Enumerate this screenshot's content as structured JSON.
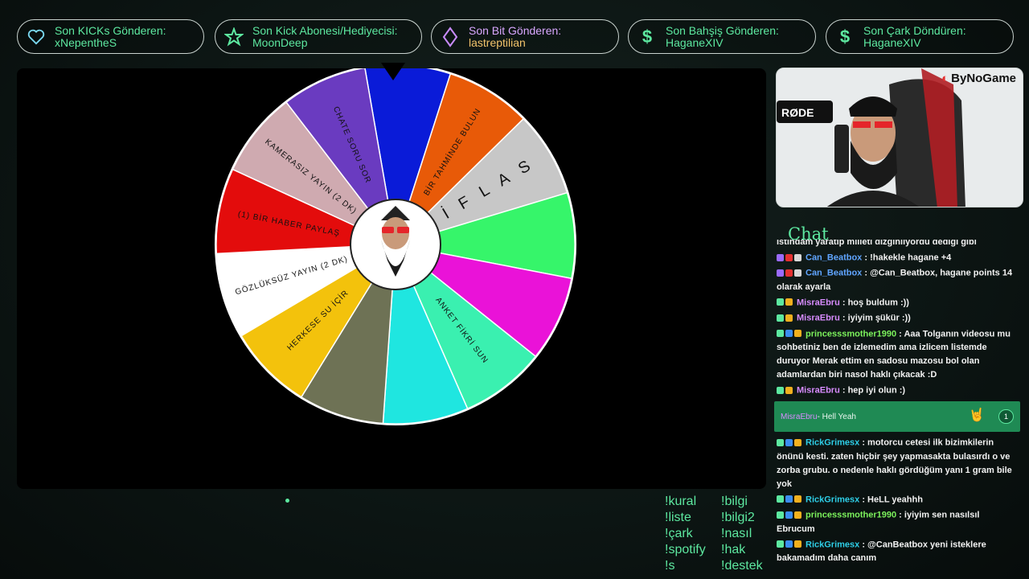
{
  "alerts": [
    {
      "label": "Son KICKs Gönderen:",
      "value": "xNepentheS",
      "icon": "heart-icon"
    },
    {
      "label": "Son Kick Abonesi/Hediyecisi:",
      "value": "MoonDeep",
      "icon": "star-icon"
    },
    {
      "label": "Son Bit Gönderen:",
      "value": "lastreptilian",
      "icon": "diamond-icon"
    },
    {
      "label": "Son Bahşiş Gönderen:",
      "value": "HaganeXIV",
      "icon": "dollar-icon"
    },
    {
      "label": "Son Çark Döndüren:",
      "value": "HaganeXIV",
      "icon": "dollar-icon"
    }
  ],
  "wheel": {
    "segments": [
      {
        "label": "",
        "color": "#0a1bd8"
      },
      {
        "label": "BİR TAHMİNDE BULUN",
        "color": "#e85a08"
      },
      {
        "label": "İ F L A S",
        "color": "#c7c7c7"
      },
      {
        "label": "",
        "color": "#36f56a"
      },
      {
        "label": "",
        "color": "#ea12d8"
      },
      {
        "label": "ANKET FİKRİ SUN",
        "color": "#3af0b0"
      },
      {
        "label": "",
        "color": "#1fe6e0"
      },
      {
        "label": "",
        "color": "#6e7255"
      },
      {
        "label": "HERKESE SU İÇİR",
        "color": "#f3c20c"
      },
      {
        "label": "GÖZLÜKSÜZ YAYIN (2 DK)",
        "color": "#ffffff"
      },
      {
        "label": "(1) BİR HABER PAYLAŞ",
        "color": "#e30c0c"
      },
      {
        "label": "KAMERASIZ YAYIN (2 DK)",
        "color": "#cfaab0"
      },
      {
        "label": "CHATE SORU SOR",
        "color": "#6a3bc0"
      }
    ]
  },
  "camera": {
    "brand": "ByNoGame"
  },
  "chat": {
    "title": "Chat",
    "partial_top": "istihdam yaratıp milleti dizginliyordu dediği gibi",
    "messages": [
      {
        "user": "Can_Beatbox",
        "cls": "u-can",
        "text": " : !hakekle hagane +4"
      },
      {
        "user": "Can_Beatbox",
        "cls": "u-can",
        "text": " : @Can_Beatbox, hagane points 14 olarak ayarla"
      },
      {
        "user": "MisraEbru",
        "cls": "u-misra",
        "text": " : hoş buldum :))"
      },
      {
        "user": "MisraEbru",
        "cls": "u-misra",
        "text": " : iyiyim şükür :))"
      },
      {
        "user": "princesssmother1990",
        "cls": "u-prin",
        "text": " : Aaa Tolganın videosu mu sohbetiniz ben de izlemedim ama izlicem listemde duruyor Merak ettim en sadosu mazosu bol olan adamlardan biri nasol haklı çıkacak :D"
      },
      {
        "user": "MisraEbru",
        "cls": "u-misra",
        "text": " : hep iyi olun :)"
      }
    ],
    "highlight": {
      "user": "MisraEbru",
      "text": " - Hell Yeah",
      "count": "1"
    },
    "messages2": [
      {
        "user": "RickGrimesx",
        "cls": "u-rick",
        "text": " : motorcu cetesi ilk bizimkilerin önünü kesti. zaten hiçbir şey yapmasakta bulasırdı o ve zorba grubu. o nedenle haklı gördüğüm yanı 1 gram bile yok"
      },
      {
        "user": "RickGrimesx",
        "cls": "u-rick",
        "text": " : HeLL yeahhh"
      },
      {
        "user": "princesssmother1990",
        "cls": "u-prin",
        "text": " : iyiyim sen nasılsıl Ebrucum"
      },
      {
        "user": "RickGrimesx",
        "cls": "u-rick",
        "text": " : @CanBeatbox yeni isteklere bakamadım daha canım"
      },
      {
        "user": "princesssmother1990",
        "cls": "u-prin",
        "text": " :"
      }
    ]
  },
  "commands": [
    "!kural",
    "!bilgi",
    "!liste",
    "!bilgi2",
    "!çark",
    "!nasıl",
    "!spotify",
    "!hak",
    "!s",
    "!destek"
  ]
}
